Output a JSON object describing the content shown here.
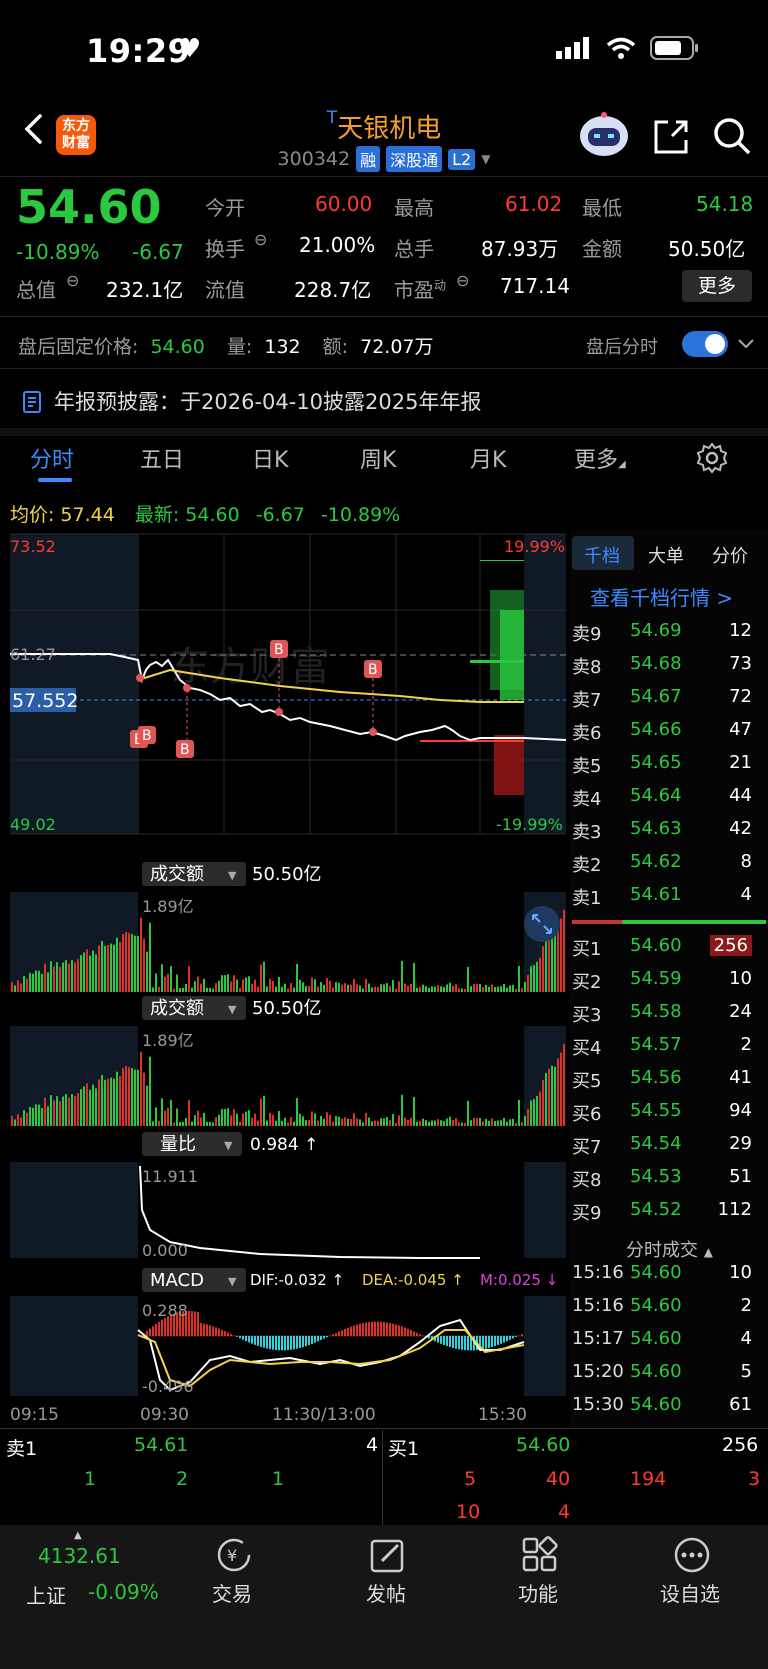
{
  "status": {
    "time": "19:29"
  },
  "header": {
    "logo_text": "东方财富",
    "title_prefix": "T",
    "title": "天银机电",
    "code": "300342",
    "tags": [
      "融",
      "深股通",
      "L2"
    ]
  },
  "quote": {
    "price": "54.60",
    "change_pct": "-10.89%",
    "change": "-6.67",
    "open_label": "今开",
    "open": "60.00",
    "high_label": "最高",
    "high": "61.02",
    "low_label": "最低",
    "low": "54.18",
    "turnover_label": "换手",
    "turnover": "21.00%",
    "volume_label": "总手",
    "volume": "87.93万",
    "amount_label": "金额",
    "amount": "50.50亿",
    "mktcap_label": "总值",
    "mktcap": "232.1亿",
    "float_label": "流值",
    "float": "228.7亿",
    "pe_label": "市盈",
    "pe_sup": "动",
    "pe": "717.14",
    "more_label": "更多"
  },
  "after_hours": {
    "price_label": "盘后固定价格:",
    "price": "54.60",
    "vol_label": "量:",
    "vol": "132",
    "amt_label": "额:",
    "amt": "72.07万",
    "toggle_label": "盘后分时"
  },
  "notice": "年报预披露：于2026-04-10披露2025年年报",
  "tabs": [
    "分时",
    "五日",
    "日K",
    "周K",
    "月K",
    "更多"
  ],
  "avg": {
    "label": "均价:",
    "value": "57.44",
    "latest_label": "最新:",
    "latest": "54.60",
    "chg": "-6.67",
    "pct": "-10.89%"
  },
  "chart": {
    "y_top": "73.52",
    "y_prev": "61.27",
    "y_cur": "57.552",
    "y_bottom": "49.02",
    "pct_top": "19.99%",
    "pct_bottom": "-19.99%",
    "watermark": "东方财富",
    "vol_label": "成交额",
    "vol_value": "50.50亿",
    "vol_max": "1.89亿",
    "ratio_label": "量比",
    "ratio_value": "0.984 ↑",
    "ratio_max": "11.911",
    "ratio_min": "0.000",
    "macd_label": "MACD",
    "dif": "DIF:-0.032 ↑",
    "dea": "DEA:-0.045 ↑",
    "m": "M:0.025 ↓",
    "macd_max": "0.288",
    "macd_min": "-0.496",
    "times": [
      "09:15",
      "09:30",
      "11:30/13:00",
      "15:30"
    ],
    "markers": [
      "B",
      "B",
      "B",
      "B",
      "B",
      "B"
    ]
  },
  "orderbook": {
    "tabs": [
      "千档",
      "大单",
      "分价"
    ],
    "link": "查看千档行情 >",
    "asks": [
      {
        "label": "卖9",
        "price": "54.69",
        "vol": "12"
      },
      {
        "label": "卖8",
        "price": "54.68",
        "vol": "73"
      },
      {
        "label": "卖7",
        "price": "54.67",
        "vol": "72"
      },
      {
        "label": "卖6",
        "price": "54.66",
        "vol": "47"
      },
      {
        "label": "卖5",
        "price": "54.65",
        "vol": "21"
      },
      {
        "label": "卖4",
        "price": "54.64",
        "vol": "44"
      },
      {
        "label": "卖3",
        "price": "54.63",
        "vol": "42"
      },
      {
        "label": "卖2",
        "price": "54.62",
        "vol": "8"
      },
      {
        "label": "卖1",
        "price": "54.61",
        "vol": "4"
      }
    ],
    "bids": [
      {
        "label": "买1",
        "price": "54.60",
        "vol": "256"
      },
      {
        "label": "买2",
        "price": "54.59",
        "vol": "10"
      },
      {
        "label": "买3",
        "price": "54.58",
        "vol": "24"
      },
      {
        "label": "买4",
        "price": "54.57",
        "vol": "2"
      },
      {
        "label": "买5",
        "price": "54.56",
        "vol": "41"
      },
      {
        "label": "买6",
        "price": "54.55",
        "vol": "94"
      },
      {
        "label": "买7",
        "price": "54.54",
        "vol": "29"
      },
      {
        "label": "买8",
        "price": "54.53",
        "vol": "51"
      },
      {
        "label": "买9",
        "price": "54.52",
        "vol": "112"
      }
    ],
    "ticks_title": "分时成交",
    "ticks": [
      {
        "t": "15:16",
        "p": "54.60",
        "v": "10"
      },
      {
        "t": "15:16",
        "p": "54.60",
        "v": "2"
      },
      {
        "t": "15:17",
        "p": "54.60",
        "v": "4"
      },
      {
        "t": "15:20",
        "p": "54.60",
        "v": "5"
      },
      {
        "t": "15:30",
        "p": "54.60",
        "v": "61"
      }
    ]
  },
  "queue": {
    "ask_label": "卖1",
    "ask_price": "54.61",
    "ask_vol": "4",
    "bid_label": "买1",
    "bid_price": "54.60",
    "bid_vol": "256",
    "ask_orders": [
      "1",
      "2",
      "1"
    ],
    "bid_orders": [
      "5",
      "40",
      "194",
      "3",
      "10",
      "4"
    ]
  },
  "bottom_nav": {
    "index_value": "4132.61",
    "index_name": "上证",
    "index_pct": "-0.09%",
    "items": [
      "交易",
      "发帖",
      "功能",
      "设自选"
    ]
  }
}
